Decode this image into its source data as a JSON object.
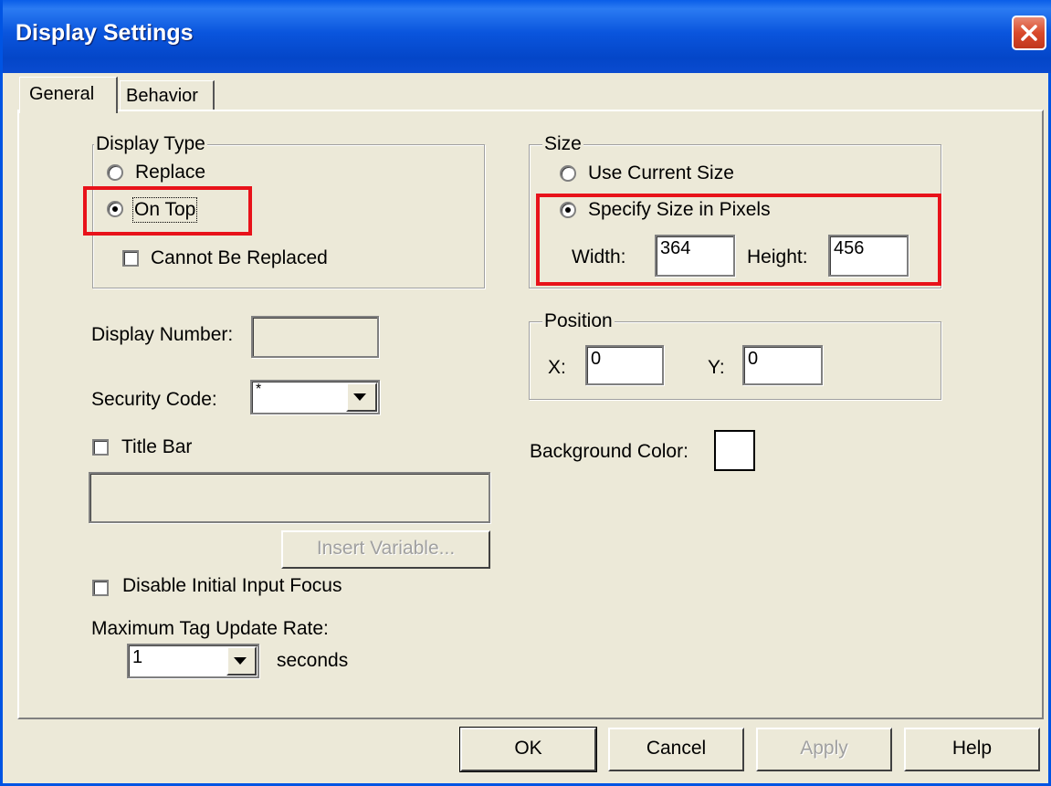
{
  "window": {
    "title": "Display Settings"
  },
  "tabs": [
    {
      "label": "General"
    },
    {
      "label": "Behavior"
    }
  ],
  "display_type": {
    "legend": "Display Type",
    "options": [
      {
        "label": "Replace",
        "selected": false
      },
      {
        "label": "On Top",
        "selected": true
      }
    ],
    "cannot_be_replaced": {
      "label": "Cannot Be Replaced",
      "checked": false
    }
  },
  "display_number": {
    "label": "Display Number:",
    "value": ""
  },
  "security_code": {
    "label": "Security Code:",
    "value": "*"
  },
  "title_bar": {
    "label": "Title Bar",
    "checked": false,
    "value": ""
  },
  "insert_variable": {
    "label": "Insert Variable..."
  },
  "disable_focus": {
    "label": "Disable Initial Input Focus",
    "checked": false
  },
  "update_rate": {
    "label": "Maximum Tag Update Rate:",
    "value": "1",
    "unit": "seconds"
  },
  "size": {
    "legend": "Size",
    "options": [
      {
        "label": "Use Current Size",
        "selected": false
      },
      {
        "label": "Specify Size in Pixels",
        "selected": true
      }
    ],
    "width_label": "Width:",
    "width": "364",
    "height_label": "Height:",
    "height": "456"
  },
  "position": {
    "legend": "Position",
    "x_label": "X:",
    "x": "0",
    "y_label": "Y:",
    "y": "0"
  },
  "background_color": {
    "label": "Background Color:",
    "color": "#ffffff"
  },
  "buttons": {
    "ok": "OK",
    "cancel": "Cancel",
    "apply": "Apply",
    "help": "Help"
  },
  "colors": {
    "highlight": "#e8121a",
    "titlebar": "#0a55dd",
    "face": "#ece9d8"
  }
}
